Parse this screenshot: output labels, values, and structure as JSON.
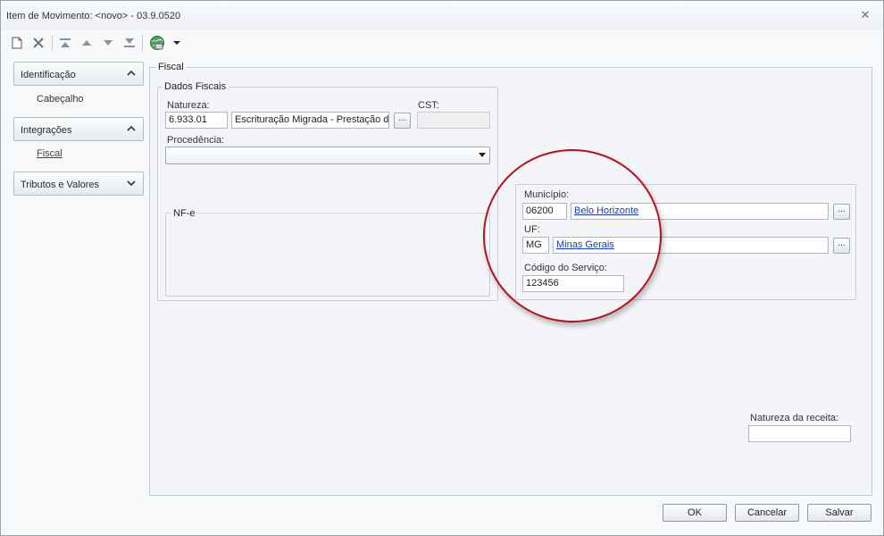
{
  "window": {
    "title": "Item de Movimento: <novo> - 03.9.0520"
  },
  "toolbar": {
    "icons": [
      "new-document-icon",
      "delete-icon",
      "move-first-icon",
      "move-up-icon",
      "move-down-icon",
      "move-last-icon",
      "globe-icon",
      "dropdown-arrow-icon"
    ]
  },
  "sidebar": {
    "groups": [
      {
        "label": "Identificação",
        "items": [
          "Cabeçalho"
        ]
      },
      {
        "label": "Integrações",
        "items": [
          "Fiscal"
        ]
      },
      {
        "label": "Tributos e Valores",
        "items": []
      }
    ]
  },
  "fiscal": {
    "title": "Fiscal",
    "dados_fiscais": {
      "title": "Dados Fiscais",
      "natureza_label": "Natureza:",
      "natureza_code": "6.933.01",
      "natureza_desc": "Escrituração Migrada - Prestação de",
      "cst_label": "CST:",
      "cst_value": "",
      "procedencia_label": "Procedência:",
      "procedencia_value": "",
      "nfe_label": "NF-e",
      "browse_label": "..."
    },
    "servico": {
      "municipio_label": "Município:",
      "municipio_code": "06200",
      "municipio_name": "Belo Horizonte",
      "uf_label": "UF:",
      "uf_code": "MG",
      "uf_name": "Minas Gerais",
      "codigo_label": "Código do Serviço:",
      "codigo_value": "123456"
    },
    "natureza_receita_label": "Natureza da receita:",
    "natureza_receita_value": ""
  },
  "buttons": {
    "ok": "OK",
    "cancelar": "Cancelar",
    "salvar": "Salvar"
  },
  "colors": {
    "highlight_circle": "#b3121e",
    "link": "#1a3cb0"
  }
}
